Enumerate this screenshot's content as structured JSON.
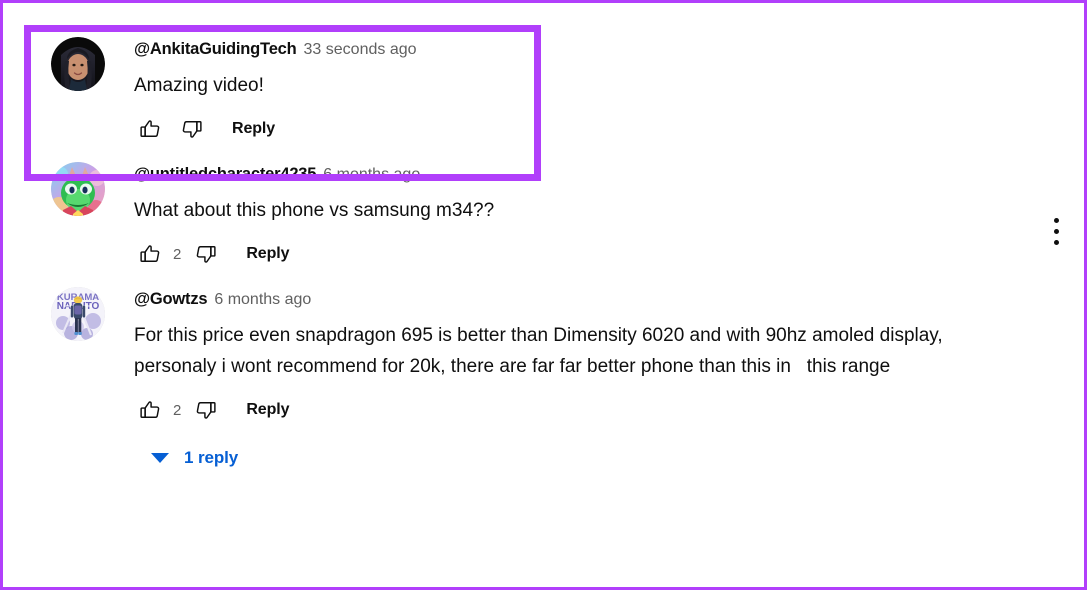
{
  "theme": {
    "highlight_color": "#b13ffb",
    "link_color": "#065fd4",
    "text_color": "#0f0f0f",
    "secondary_text_color": "#606060"
  },
  "overflow_menu": {
    "name": "more-actions"
  },
  "comments": [
    {
      "author": "@AnkitaGuidingTech",
      "timestamp": "33 seconds ago",
      "text": "Amazing video!",
      "like_count": "",
      "reply_label": "Reply",
      "highlighted": true,
      "avatar": "woman-selfie-photo"
    },
    {
      "author": "@untitledcharacter4235",
      "timestamp": "6 months ago",
      "text": "What about this phone vs samsung m34??",
      "like_count": "2",
      "reply_label": "Reply",
      "highlighted": false,
      "avatar": "green-dragon-cartoon"
    },
    {
      "author": "@Gowtzs",
      "timestamp": "6 months ago",
      "text": "For this price even snapdragon 695 is better than Dimensity 6020 and with 90hz amoled display, personaly i wont recommend for 20k, there are far far better phone than this in   this range",
      "like_count": "2",
      "reply_label": "Reply",
      "highlighted": false,
      "avatar": "naruto-character-art",
      "replies": {
        "label": "1 reply",
        "expanded": false
      }
    }
  ]
}
